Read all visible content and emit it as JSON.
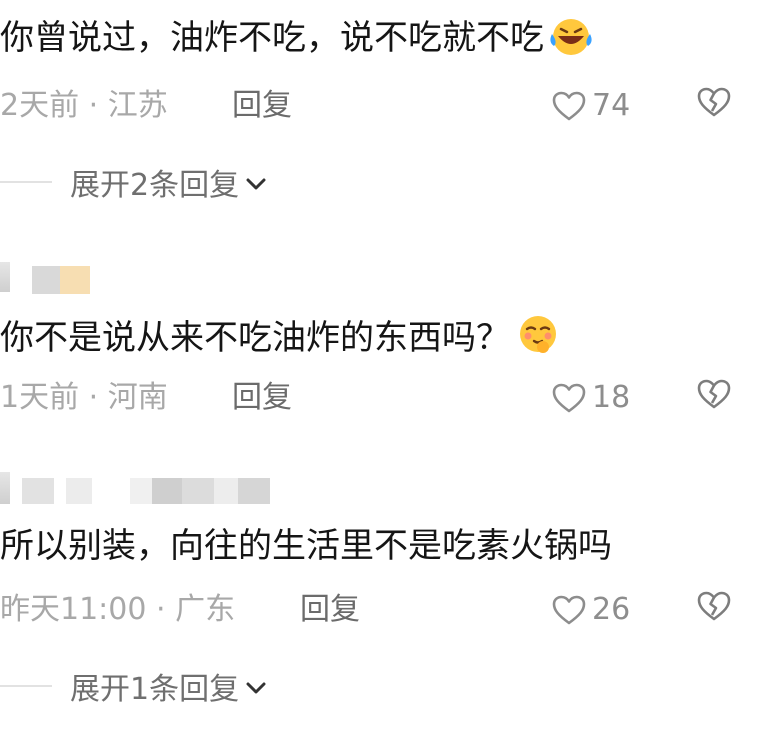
{
  "comments": [
    {
      "text": "你曾说过，油炸不吃，说不吃就不吃",
      "emoji": "rofl-emoji",
      "time": "2天前",
      "separator": "·",
      "location": "江苏",
      "reply_label": "回复",
      "likes": "74"
    },
    {
      "text": "你不是说从来不吃油炸的东西吗？",
      "emoji": "shy-face-emoji",
      "time": "1天前",
      "separator": "·",
      "location": "河南",
      "reply_label": "回复",
      "likes": "18"
    },
    {
      "text": "所以别装，向往的生活里不是吃素火锅吗",
      "time": "昨天11:00",
      "separator": "·",
      "location": "广东",
      "reply_label": "回复",
      "likes": "26"
    }
  ],
  "expand": [
    {
      "label": "展开2条回复"
    },
    {
      "label": "展开1条回复"
    }
  ],
  "icons": {
    "like": "heart-outline-icon",
    "dislike": "broken-heart-icon",
    "expand": "chevron-down-icon"
  },
  "colors": {
    "text": "#151515",
    "meta": "#a8a8a8",
    "reply": "#6b6b6b",
    "icon": "#8d8d8d"
  }
}
